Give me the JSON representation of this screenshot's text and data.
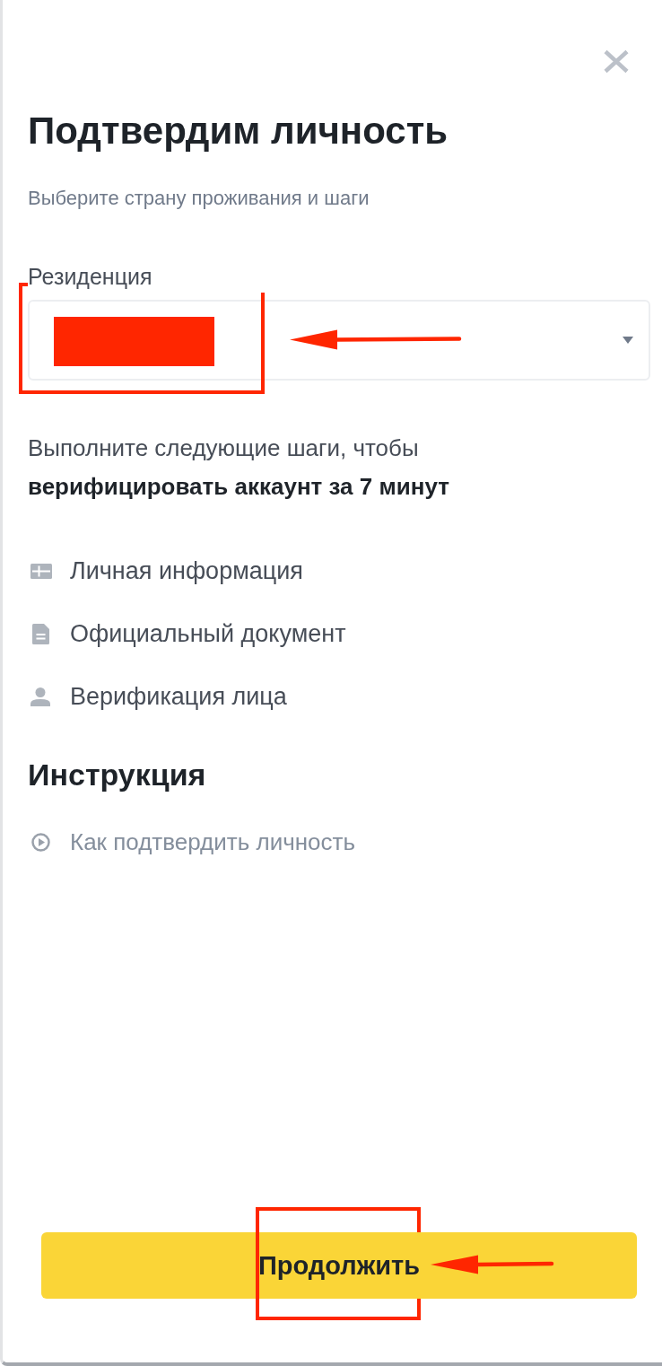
{
  "dialog": {
    "title": "Подтвердим личность",
    "subtitle": "Выберите страну проживания и шаги"
  },
  "residence": {
    "label": "Резиденция",
    "redacted": true,
    "annotated": true
  },
  "intro": "Выполните следующие шаги, чтобы **верифицировать аккаунт за 7 минут**",
  "steps": [
    {
      "kind": "card",
      "label": "Личная информация"
    },
    {
      "kind": "document",
      "label": "Официальный документ"
    },
    {
      "kind": "person",
      "label": "Верификация лица"
    }
  ],
  "instruction": {
    "title": "Инструкция",
    "link": "Как подтвердить личность"
  },
  "continue_button": {
    "label": "Продолжить",
    "annotated": true
  }
}
